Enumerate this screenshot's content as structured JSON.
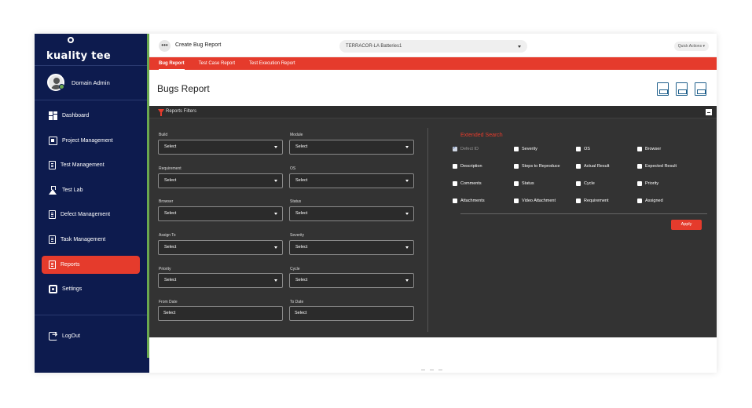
{
  "app": {
    "logo_text": "kuality tee"
  },
  "user": {
    "name": "Domain Admin"
  },
  "sidebar": {
    "items": [
      {
        "label": "Dashboard",
        "icon": "dashboard-icon"
      },
      {
        "label": "Project Management",
        "icon": "project-icon"
      },
      {
        "label": "Test Management",
        "icon": "test-management-icon"
      },
      {
        "label": "Test Lab",
        "icon": "flask-icon"
      },
      {
        "label": "Defect Management",
        "icon": "defect-icon"
      },
      {
        "label": "Task Management",
        "icon": "task-icon"
      },
      {
        "label": "Reports",
        "icon": "reports-icon",
        "active": true
      },
      {
        "label": "Settings",
        "icon": "gear-icon"
      }
    ],
    "logout": "LogOut"
  },
  "topbar": {
    "title": "Create Bug Report",
    "project": "TERRACOR-LA Batteries1",
    "quick_actions": "Quick Actions"
  },
  "tabs": [
    {
      "label": "Bug Report",
      "active": true
    },
    {
      "label": "Test Case Report"
    },
    {
      "label": "Test Execution Report"
    }
  ],
  "page": {
    "title": "Bugs Report"
  },
  "filters": {
    "title": "Reports Filters",
    "fields": [
      {
        "label": "Build",
        "value": "Select"
      },
      {
        "label": "Module",
        "value": "Select"
      },
      {
        "label": "Requirement",
        "value": "Select"
      },
      {
        "label": "OS",
        "value": "Select"
      },
      {
        "label": "Browser",
        "value": "Select"
      },
      {
        "label": "Status",
        "value": "Select"
      },
      {
        "label": "Assign To",
        "value": "Select"
      },
      {
        "label": "Severity",
        "value": "Select"
      },
      {
        "label": "Priority",
        "value": "Select"
      },
      {
        "label": "Cycle",
        "value": "Select"
      },
      {
        "label": "From Date",
        "value": "Select"
      },
      {
        "label": "To Date",
        "value": "Select"
      }
    ]
  },
  "extended": {
    "title": "Extended Search",
    "checkboxes": [
      {
        "label": "Defect ID",
        "checked": true
      },
      {
        "label": "Severity",
        "checked": false
      },
      {
        "label": "OS",
        "checked": false
      },
      {
        "label": "Browser",
        "checked": false
      },
      {
        "label": "Description",
        "checked": false
      },
      {
        "label": "Steps to Reproduce",
        "checked": false
      },
      {
        "label": "Actual Result",
        "checked": false
      },
      {
        "label": "Expected Result",
        "checked": false
      },
      {
        "label": "Comments",
        "checked": false
      },
      {
        "label": "Status",
        "checked": false
      },
      {
        "label": "Cycle",
        "checked": false
      },
      {
        "label": "Priority",
        "checked": false
      },
      {
        "label": "Attachments",
        "checked": false
      },
      {
        "label": "Video Attachment",
        "checked": false
      },
      {
        "label": "Requirement",
        "checked": false
      },
      {
        "label": "Assigned",
        "checked": false
      }
    ],
    "apply_label": "Apply"
  },
  "colors": {
    "sidebar": "#0d1b4e",
    "accent": "#e53b2c",
    "panel": "#333333",
    "green": "#6aa84f"
  }
}
